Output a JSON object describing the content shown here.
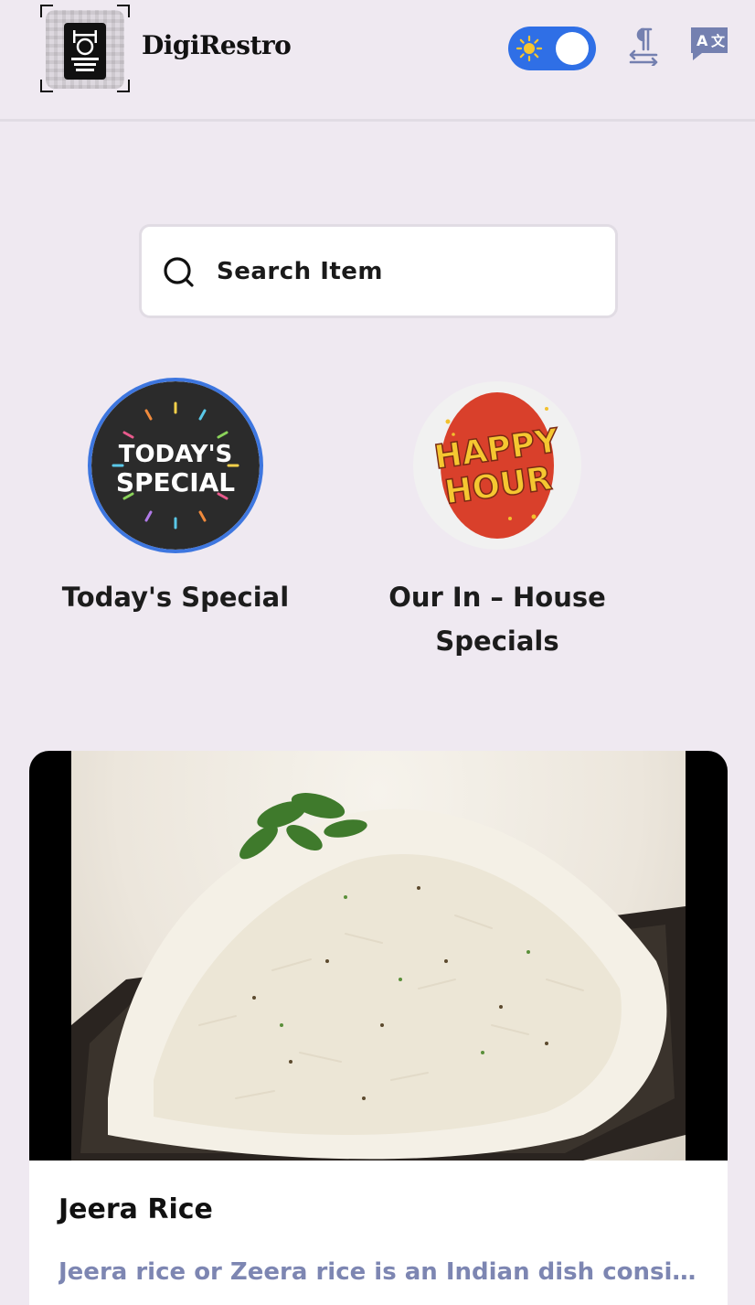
{
  "header": {
    "brand": "DigiRestro",
    "theme_toggle": {
      "mode": "light"
    },
    "icons": [
      "qr-logo-icon",
      "sun-icon",
      "text-direction-icon",
      "translate-icon"
    ]
  },
  "search": {
    "placeholder": "Search Item"
  },
  "categories": [
    {
      "label": "Today's Special",
      "badge": "TODAY'S SPECIAL",
      "selected": true
    },
    {
      "label": "Our In – House Specials",
      "badge": "HAPPY HOUR",
      "selected": false
    }
  ],
  "items": [
    {
      "title": "Jeera Rice",
      "description": "Jeera rice or Zeera rice is an Indian dish consist…"
    }
  ],
  "colors": {
    "background": "#efe9f1",
    "accent": "#2f6fe6",
    "description": "#7d86b2",
    "icon": "#7480b0"
  }
}
